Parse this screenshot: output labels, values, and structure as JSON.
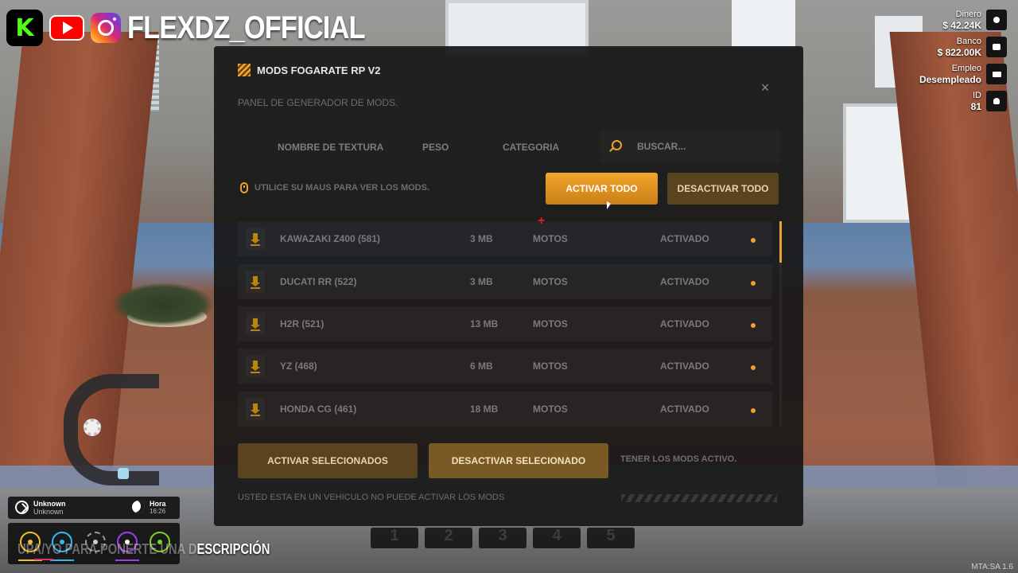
{
  "brand": {
    "kick_letter": "K",
    "channel_name": "FLEXDZ_OFFICIAL"
  },
  "hud": {
    "stats": [
      {
        "label": "Dinero",
        "value": "$ 42.24K",
        "icon": "disc-icon"
      },
      {
        "label": "Banco",
        "value": "$ 822.00K",
        "icon": "bank-icon"
      },
      {
        "label": "Empleo",
        "value": "Desempleado",
        "icon": "briefcase-icon"
      },
      {
        "label": "ID",
        "value": "81",
        "icon": "user-icon"
      }
    ]
  },
  "modal": {
    "title": "MODS FOGARATE RP V2",
    "close": "×",
    "subtitle": "PANEL DE GENERADOR DE MODS.",
    "columns": {
      "name": "NOMBRE DE TEXTURA",
      "size": "PESO",
      "category": "CATEGORIA"
    },
    "search": {
      "placeholder": "BUSCAR..."
    },
    "hint": "UTILICE SU MAUS PARA VER LOS MODS.",
    "buttons": {
      "activate_all": "ACTIVAR TODO",
      "deactivate_all": "DESACTIVAR TODO",
      "activate_selected": "ACTIVAR SELECIONADOS",
      "deactivate_selected": "DESACTIVAR SELECIONADO"
    },
    "mods": [
      {
        "name": "KAWAZAKI Z400 (581)",
        "size": "3 MB",
        "category": "MOTOS",
        "status": "ACTIVADO"
      },
      {
        "name": "DUCATI RR (522)",
        "size": "3 MB",
        "category": "MOTOS",
        "status": "ACTIVADO"
      },
      {
        "name": "H2R (521)",
        "size": "13 MB",
        "category": "MOTOS",
        "status": "ACTIVADO"
      },
      {
        "name": "YZ (468)",
        "size": "6 MB",
        "category": "MOTOS",
        "status": "ACTIVADO"
      },
      {
        "name": "HONDA CG (461)",
        "size": "18 MB",
        "category": "MOTOS",
        "status": "ACTIVADO"
      }
    ],
    "footer_note": "TENER LOS MODS ACTIVO.",
    "warning": "USTED ESTA EN UN VEHICULO NO PUEDE ACTIVAR LOS MODS"
  },
  "hotbar": [
    "1",
    "2",
    "3",
    "4",
    "5"
  ],
  "bottom_hud": {
    "location": "Unknown",
    "location_sub": "Unknown",
    "time_label": "Hora",
    "time_value": "16:26"
  },
  "subtitle_overlay": {
    "faded": "UPA/YO PARA PONERTE UNA D",
    "bright": "ESCRIPCIÓN"
  },
  "version": "MTA:SA 1.6",
  "colors": {
    "accent": "#f0a12b",
    "panel": "#181818",
    "crosshair": "#e21b1b"
  }
}
